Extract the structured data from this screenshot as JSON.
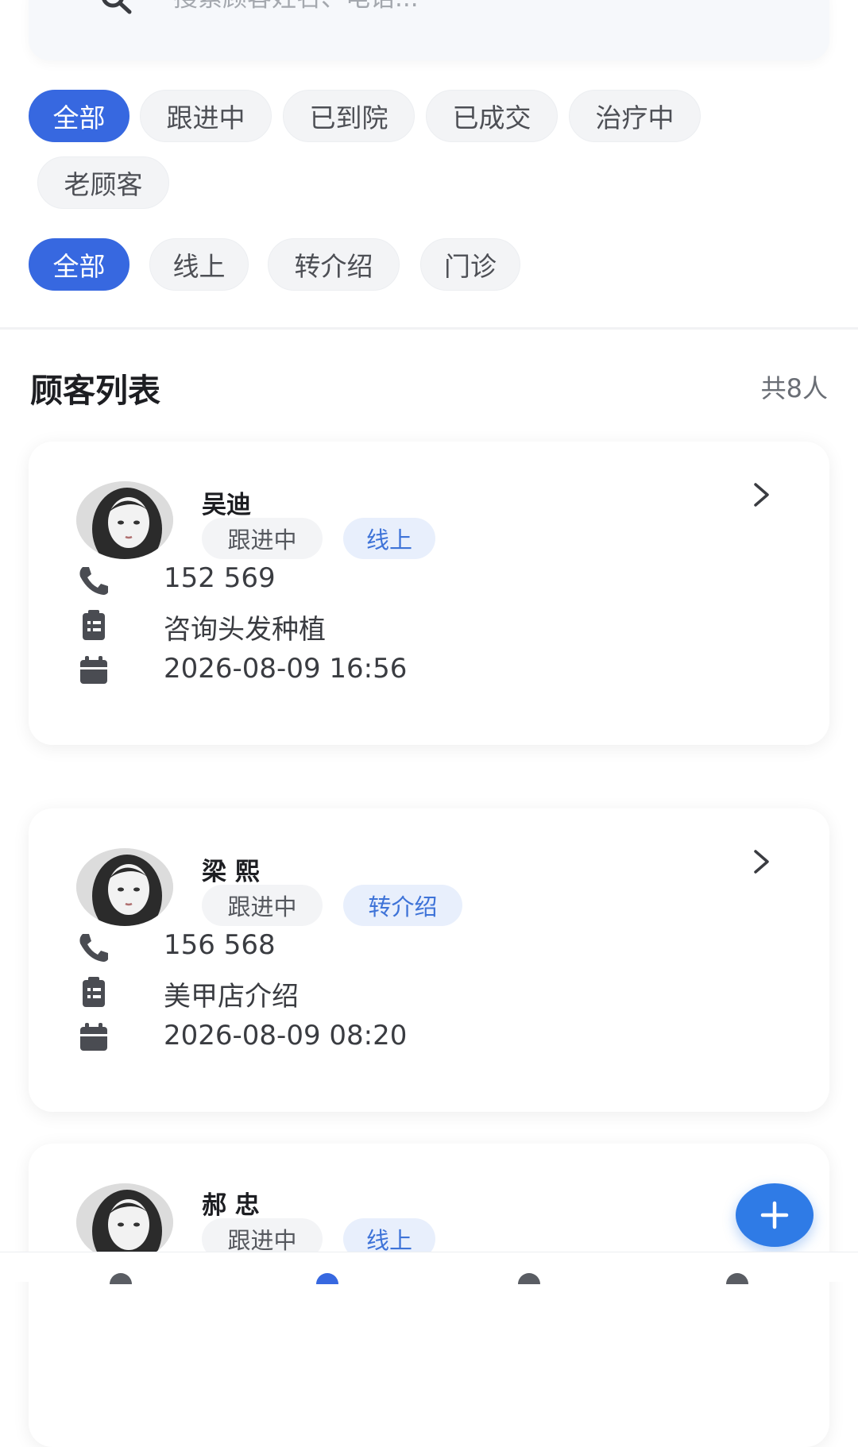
{
  "search": {
    "placeholder": "搜索顾客姓名、电话...",
    "value": "",
    "icon": "search-icon"
  },
  "status_filters": [
    {
      "label": "全部",
      "active": true
    },
    {
      "label": "跟进中",
      "active": false
    },
    {
      "label": "已到院",
      "active": false
    },
    {
      "label": "已成交",
      "active": false
    },
    {
      "label": "治疗中",
      "active": false
    },
    {
      "label": "老顾客",
      "active": false
    }
  ],
  "source_filters": [
    {
      "label": "全部",
      "active": true
    },
    {
      "label": "线上",
      "active": false
    },
    {
      "label": "转介绍",
      "active": false
    },
    {
      "label": "门诊",
      "active": false
    }
  ],
  "list": {
    "title": "顾客列表",
    "count": "共8人"
  },
  "customers": [
    {
      "name": "吴迪",
      "status": "跟进中",
      "source": "线上",
      "phone": "152 569",
      "note": "咨询头发种植",
      "datetime": "2026-08-09 16:56"
    },
    {
      "name": "梁 熙",
      "status": "跟进中",
      "source": "转介绍",
      "phone": "156 568",
      "note": "美甲店介绍",
      "datetime": "2026-08-09 08:20"
    },
    {
      "name": "郝 忠",
      "status": "跟进中",
      "source": "线上"
    }
  ],
  "fab": {
    "icon": "plus-icon"
  },
  "colors": {
    "accent": "#3768e0",
    "fab": "#2f7be6",
    "source_tag_text": "#3e73d8",
    "source_tag_bg": "#e8effc"
  }
}
